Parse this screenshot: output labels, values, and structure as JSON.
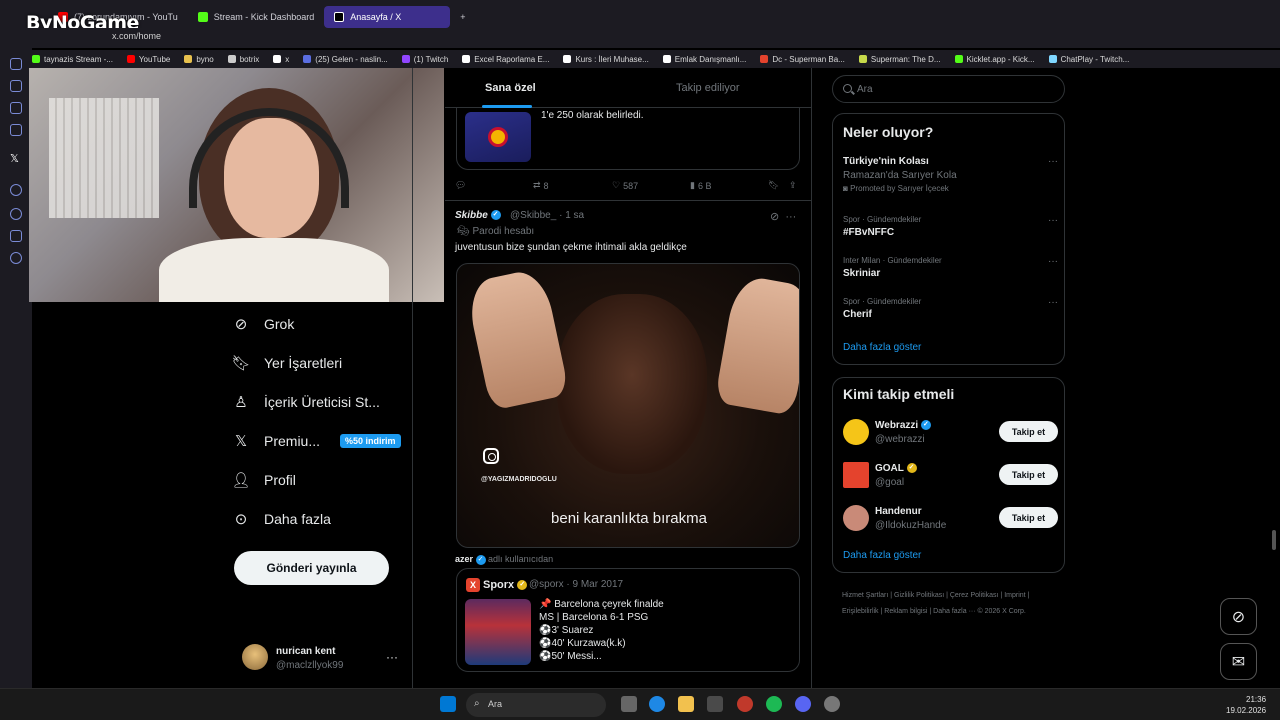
{
  "browser": {
    "tabs": [
      {
        "label": "(7) zorundamıyım - YouTu"
      },
      {
        "label": "Stream - Kick Dashboard"
      },
      {
        "label": "Anasayfa / X"
      }
    ],
    "url": "x.com/home",
    "brand": "ByNoGame",
    "bookmarks": [
      "taynazis Stream -...",
      "YouTube",
      "byno",
      "botrix",
      "x",
      "(25) Gelen - naslin...",
      "(1) Twitch",
      "Excel Raporlama E...",
      "Kurs : İleri Muhase...",
      "Emlak Danışmanlı...",
      "Dc - Superman Ba...",
      "Superman: The D...",
      "Kicklet.app - Kick...",
      "ChatPlay - Twitch..."
    ]
  },
  "nav": {
    "items": [
      {
        "label": "Grok",
        "icon": "grok-icon"
      },
      {
        "label": "Yer İşaretleri",
        "icon": "bookmark-icon"
      },
      {
        "label": "İçerik Üreticisi St...",
        "icon": "creator-icon"
      },
      {
        "label": "Premiu...",
        "icon": "x-premium-icon",
        "badge": "%50 indirim"
      },
      {
        "label": "Profil",
        "icon": "profile-icon"
      },
      {
        "label": "Daha fazla",
        "icon": "more-circle-icon"
      }
    ],
    "post_button": "Gönderi yayınla",
    "user": {
      "name": "nurican kent",
      "handle": "@maclzllyok99",
      "more": "···"
    }
  },
  "feed": {
    "tabs": [
      "Sana özel",
      "Takip ediliyor"
    ],
    "prev_tweet": {
      "card_text": "1'e 250 olarak belirledi.",
      "stats": {
        "replies": "",
        "retweets": "8",
        "likes": "587",
        "views": "6 B"
      }
    },
    "tweet": {
      "author": "Skibbe",
      "handle": "@Skibbe_",
      "time": "1 sa",
      "parody": "Parodi hesabı",
      "text": "juventusun bize şundan çekme ihtimali akla geldikçe",
      "media": {
        "watermark": "@YAGIZMADRIDOGLU",
        "caption": "beni karanlıkta bırakma"
      },
      "quote_source_name": "azer",
      "quote_source_suffix": "adlı kullanıcıdan",
      "quote": {
        "logo": "X",
        "author": "Sporx",
        "handle": "@sporx",
        "date": "9 Mar 2017",
        "lines": [
          "📌 Barcelona çeyrek finalde",
          "MS | Barcelona 6-1 PSG",
          "⚽3' Suarez",
          "⚽40' Kurzawa(k.k)",
          "⚽50' Messi..."
        ]
      }
    }
  },
  "sidebar": {
    "search_placeholder": "Ara",
    "trends_title": "Neler oluyor?",
    "trends": [
      {
        "name": "Türkiye'nin Kolası",
        "sub": "Ramazan'da Sarıyer Kola",
        "promo": "Promoted by Sarıyer İçecek"
      },
      {
        "context": "Spor · Gündemdekiler",
        "name": "#FBvNFFC"
      },
      {
        "context": "Inter Milan · Gündemdekiler",
        "name": "Skriniar"
      },
      {
        "context": "Spor · Gündemdekiler",
        "name": "Cherif"
      }
    ],
    "show_more": "Daha fazla göster",
    "who_title": "Kimi takip etmeli",
    "who": [
      {
        "name": "Webrazzi",
        "handle": "@webrazzi",
        "verified": "blue",
        "button": "Takip et",
        "avatar_color": "#f5c518"
      },
      {
        "name": "GOAL",
        "handle": "@goal",
        "verified": "gold",
        "button": "Takip et",
        "avatar_color": "#e4432d"
      },
      {
        "name": "Handenur",
        "handle": "@IldokuzHande",
        "verified": "none",
        "button": "Takip et",
        "avatar_color": "#c98a78"
      }
    ],
    "footer": "Hizmet Şartları | Gizlilik Politikası | Çerez Politikası | Imprint | Erişilebilirlik | Reklam bilgisi | Daha fazla ··· © 2026 X Corp."
  },
  "taskbar": {
    "search": "Ara",
    "time": "21:36",
    "date": "19.02.2026"
  }
}
